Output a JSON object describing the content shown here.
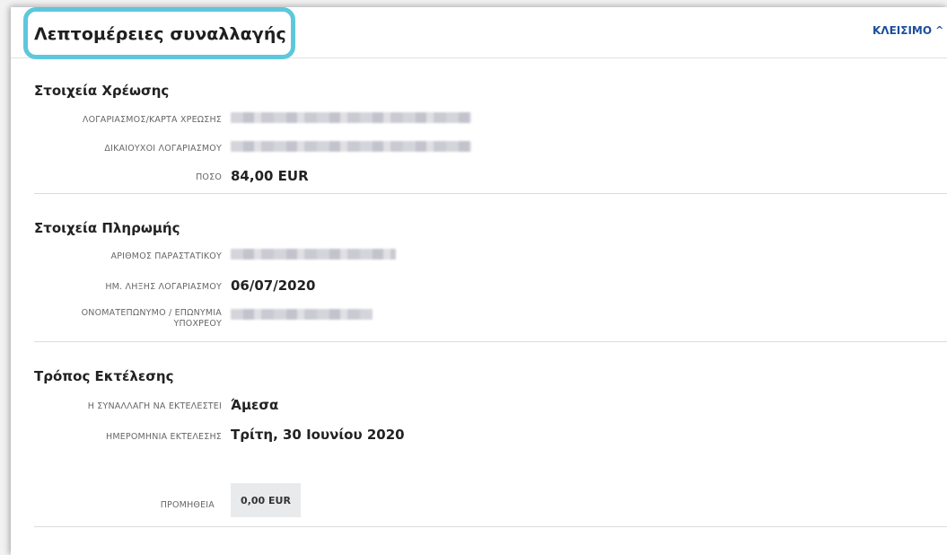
{
  "header": {
    "title": "Λεπτομέρειες συναλλαγής",
    "close_label": "ΚΛΕΙΣΙΜΟ",
    "close_icon": "chevron-up-icon"
  },
  "debit": {
    "title": "Στοιχεία Χρέωσης",
    "account_label": "ΛΟΓΑΡΙΑΣΜΟΣ/ΚΑΡΤΑ ΧΡΕΩΣΗΣ",
    "beneficiaries_label": "ΔΙΚΑΙΟΥΧΟΙ ΛΟΓΑΡΙΑΣΜΟΥ",
    "amount_label": "ΠΟΣΟ",
    "amount_value": "84,00 EUR"
  },
  "payment": {
    "title": "Στοιχεία Πληρωμής",
    "document_number_label": "ΑΡΙΘΜΟΣ ΠΑΡΑΣΤΑΤΙΚΟΥ",
    "due_date_label": "ΗΜ. ΛΗΞΗΣ ΛΟΓΑΡΙΑΣΜΟΥ",
    "due_date_value": "06/07/2020",
    "obligor_label_line1": "ΟΝΟΜΑΤΕΠΩΝΥΜΟ / ΕΠΩΝΥΜΙΑ",
    "obligor_label_line2": "ΥΠΟΧΡΕΟΥ"
  },
  "execution": {
    "title": "Τρόπος Εκτέλεσης",
    "timing_label": "Η ΣΥΝΑΛΛΑΓΗ ΝΑ ΕΚΤΕΛΕΣΤΕΙ",
    "timing_value": "Άμεσα",
    "date_label": "ΗΜΕΡΟΜΗΝΙΑ ΕΚΤΕΛΕΣΗΣ",
    "date_value": "Τρίτη, 30 Ιουνίου 2020",
    "fee_label": "ΠΡΟΜΗΘΕΙΑ",
    "fee_value": "0,00 EUR"
  },
  "colors": {
    "highlight": "#5ec7dc",
    "link": "#1c4f9c"
  }
}
